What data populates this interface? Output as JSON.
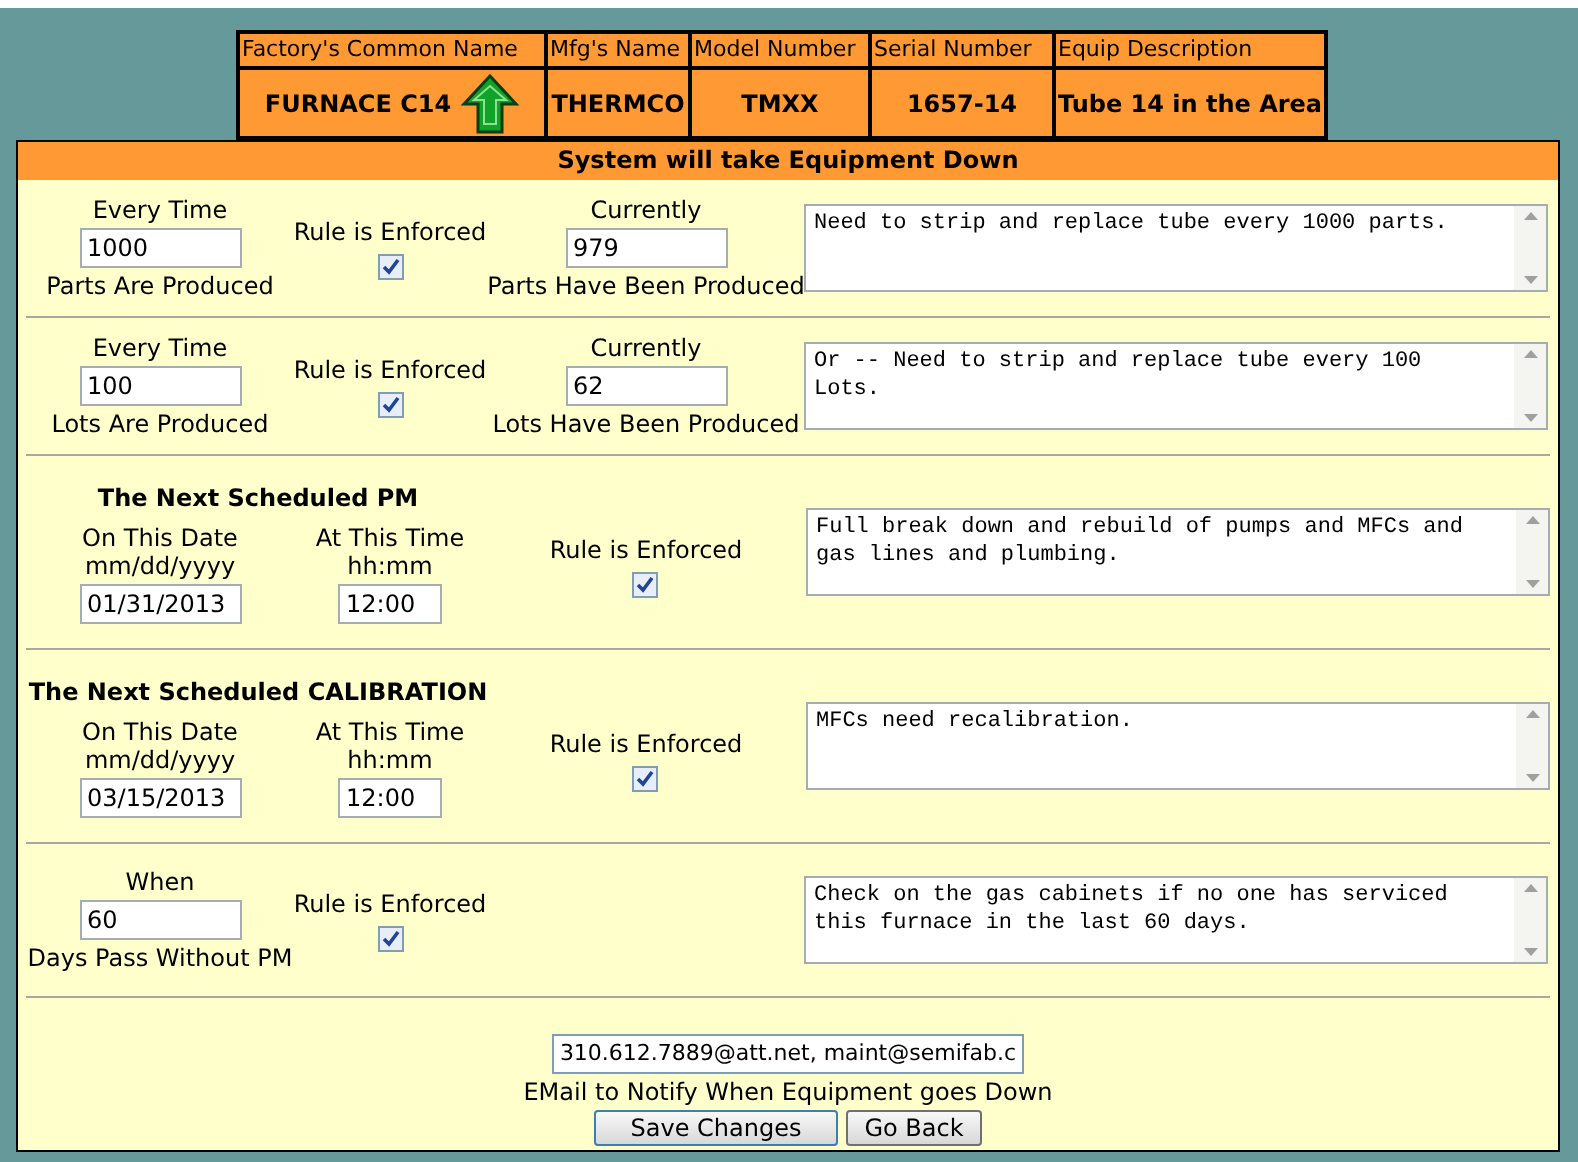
{
  "equipment_table": {
    "columns": [
      "Factory's Common Name",
      "Mfg's Name",
      "Model Number",
      "Serial Number",
      "Equip Description"
    ],
    "values": [
      "FURNACE C14",
      "THERMCO",
      "TMXX",
      "1657-14",
      "Tube 14 in the Area"
    ]
  },
  "panel": {
    "title": "System will take Equipment Down"
  },
  "rules": [
    {
      "kind": "count",
      "top_label": "Every Time",
      "value": "1000",
      "bottom_label": "Parts Are Produced",
      "enforced_label": "Rule is Enforced",
      "enforced": true,
      "current_label": "Currently",
      "current_value": "979",
      "current_bottom": "Parts Have Been Produced",
      "note": "Need to strip and replace tube every 1000 parts."
    },
    {
      "kind": "count",
      "top_label": "Every Time",
      "value": "100",
      "bottom_label": "Lots Are Produced",
      "enforced_label": "Rule is Enforced",
      "enforced": true,
      "current_label": "Currently",
      "current_value": "62",
      "current_bottom": "Lots Have Been Produced",
      "note": "Or -- Need to strip and replace tube every 100 Lots."
    },
    {
      "kind": "schedule",
      "heading": "The Next Scheduled PM",
      "date_label": "On This Date",
      "date_format": "mm/dd/yyyy",
      "date_value": "01/31/2013",
      "time_label": "At This Time",
      "time_format": "hh:mm",
      "time_value": "12:00",
      "enforced_label": "Rule is Enforced",
      "enforced": true,
      "note": "Full break down and rebuild of pumps and MFCs and gas lines and plumbing."
    },
    {
      "kind": "schedule",
      "heading": "The Next Scheduled CALIBRATION",
      "date_label": "On This Date",
      "date_format": "mm/dd/yyyy",
      "date_value": "03/15/2013",
      "time_label": "At This Time",
      "time_format": "hh:mm",
      "time_value": "12:00",
      "enforced_label": "Rule is Enforced",
      "enforced": true,
      "note": "MFCs need recalibration."
    },
    {
      "kind": "elapsed",
      "top_label": "When",
      "value": "60",
      "bottom_label": "Days Pass Without PM",
      "enforced_label": "Rule is Enforced",
      "enforced": true,
      "note": "Check on the gas cabinets if no one has serviced this furnace in the last 60 days."
    }
  ],
  "notify": {
    "email": "310.612.7889@att.net, maint@semifab.c",
    "label": "EMail to Notify When Equipment goes Down"
  },
  "buttons": [
    "Save Changes",
    "Go Back"
  ]
}
